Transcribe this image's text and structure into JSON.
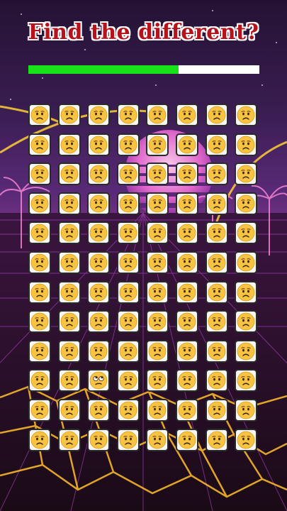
{
  "title": "Find the different?",
  "timer": {
    "progress": 0.65,
    "fill_color": "#18e318",
    "track_color": "#ffffff"
  },
  "grid": {
    "rows": 12,
    "cols": 8,
    "tile_icon": "worried-face-icon",
    "odd_icon": "rolling-eyes-face-icon",
    "odd_position": {
      "row": 10,
      "col": 3
    },
    "face_color": "#f7c342"
  }
}
